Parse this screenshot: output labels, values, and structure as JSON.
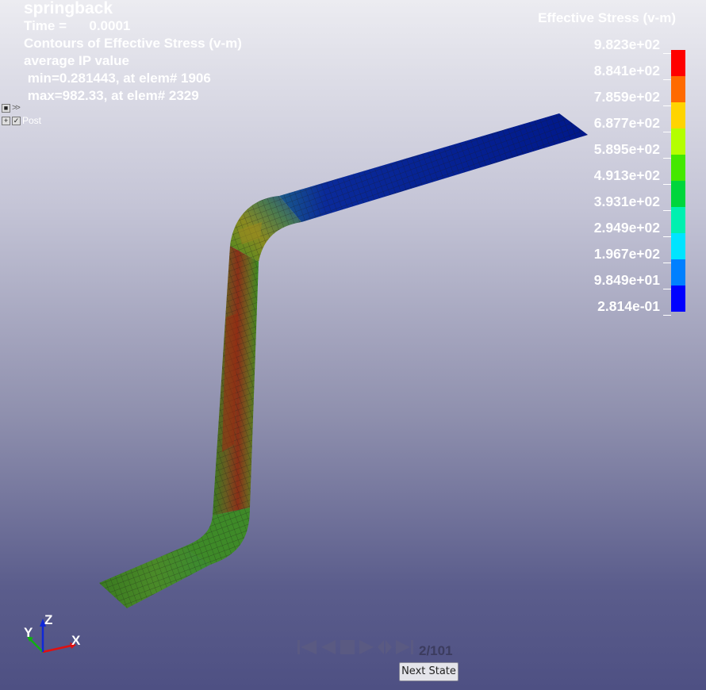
{
  "info": {
    "title": "springback",
    "time_label": "Time =",
    "time_value": "0.0001",
    "contour_line": "Contours of Effective Stress (v-m)",
    "avg_line": "average IP value",
    "min_line": " min=0.281443, at elem# 1906",
    "max_line": " max=982.33, at elem# 2329"
  },
  "tree": {
    "post_label": "Post"
  },
  "legend": {
    "title": "Effective Stress (v-m)",
    "labels": [
      "9.823e+02",
      "8.841e+02",
      "7.859e+02",
      "6.877e+02",
      "5.895e+02",
      "4.913e+02",
      "3.931e+02",
      "2.949e+02",
      "1.967e+02",
      "9.849e+01",
      "2.814e-01"
    ],
    "colors": [
      "#ff0000",
      "#ff6a00",
      "#ffd400",
      "#b4ff00",
      "#44e800",
      "#00d63c",
      "#00f0b0",
      "#00e4ff",
      "#0080ff",
      "#0000ff"
    ]
  },
  "axes": {
    "x": "X",
    "y": "Y",
    "z": "Z",
    "x_color": "#e01010",
    "y_color": "#10b010",
    "z_color": "#1028d8"
  },
  "animation": {
    "state_text": "2/101",
    "next_label": "Next State"
  }
}
